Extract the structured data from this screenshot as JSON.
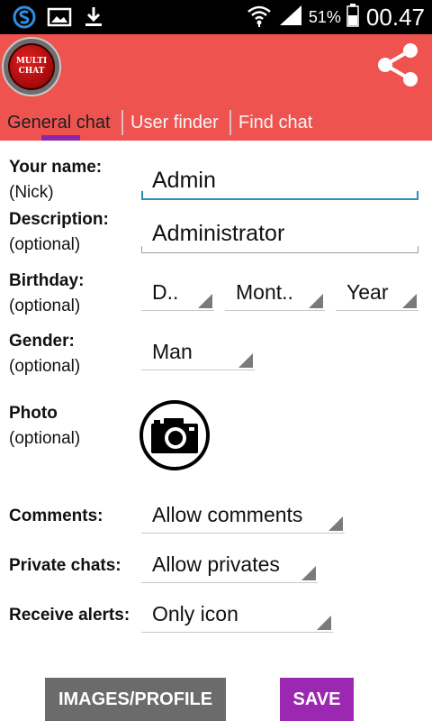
{
  "status_bar": {
    "battery_percent": "51%",
    "time": "00.47",
    "left_icons": [
      "s-app-icon",
      "image-icon",
      "download-icon"
    ],
    "right_icons": [
      "wifi-icon",
      "signal-icon",
      "battery-icon"
    ]
  },
  "app": {
    "logo_line1": "MULTI",
    "logo_line2": "CHAT",
    "share_icon": "share-icon",
    "header_color": "#ef5350",
    "tabs": [
      {
        "label": "General chat",
        "active": true
      },
      {
        "label": "User finder",
        "active": false
      },
      {
        "label": "Find chat",
        "active": false
      }
    ],
    "tab_indicator_color": "#8e24aa"
  },
  "form": {
    "name": {
      "label": "Your name:",
      "sublabel": "(Nick)",
      "value": "Admin"
    },
    "description": {
      "label": "Description:",
      "sublabel": "(optional)",
      "value": "Administrator"
    },
    "birthday": {
      "label": "Birthday:",
      "sublabel": "(optional)",
      "day": "D..",
      "month": "Mont..",
      "year": "Year"
    },
    "gender": {
      "label": "Gender:",
      "sublabel": "(optional)",
      "value": "Man"
    },
    "photo": {
      "label": "Photo",
      "sublabel": "(optional)",
      "icon": "camera-icon"
    },
    "comments": {
      "label": "Comments:",
      "value": "Allow comments"
    },
    "private_chats": {
      "label": "Private chats:",
      "value": "Allow privates"
    },
    "alerts": {
      "label": "Receive alerts:",
      "value": "Only icon"
    }
  },
  "buttons": {
    "images_profile": "IMAGES/PROFILE",
    "save": "SAVE",
    "save_color": "#9c27b0"
  }
}
